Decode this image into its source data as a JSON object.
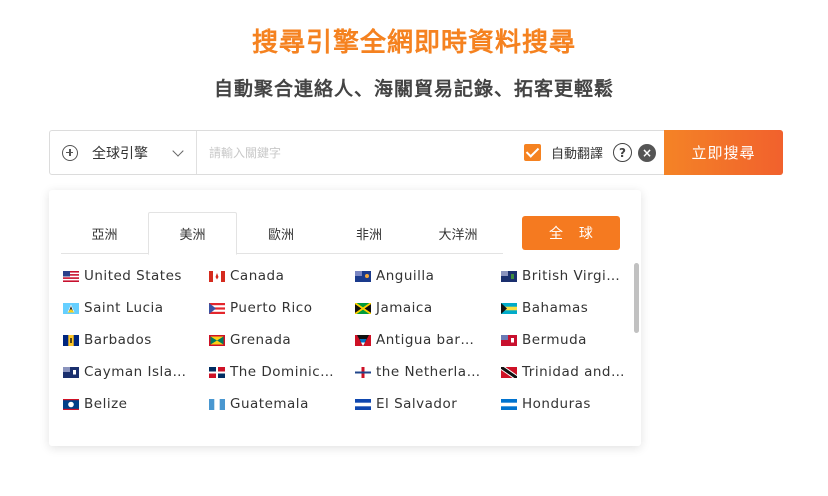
{
  "hero": {
    "title": "搜尋引擎全網即時資料搜尋",
    "subtitle": "自動聚合連絡人、海關貿易記錄、拓客更輕鬆"
  },
  "search": {
    "engine_label": "全球引擎",
    "placeholder": "請輸入關鍵字",
    "value": "",
    "auto_translate_label": "自動翻譯",
    "auto_translate_checked": true,
    "help_icon": "?",
    "clear_icon": "×",
    "submit_label": "立即搜尋"
  },
  "dropdown": {
    "tabs": [
      "亞洲",
      "美洲",
      "歐洲",
      "非洲",
      "大洋洲"
    ],
    "active_tab": "美洲",
    "all_label": "全 球",
    "countries": [
      [
        "United States",
        "Canada",
        "Anguilla",
        "British Virgi…"
      ],
      [
        "Saint Lucia",
        "Puerto Rico",
        "Jamaica",
        "Bahamas"
      ],
      [
        "Barbados",
        "Grenada",
        "Antigua bar…",
        "Bermuda"
      ],
      [
        "Cayman Isla…",
        "The Dominic…",
        "the Netherla…",
        "Trinidad and…"
      ],
      [
        "Belize",
        "Guatemala",
        "El Salvador",
        "Honduras"
      ]
    ],
    "flag_icons": [
      [
        "us-flag-icon",
        "ca-flag-icon",
        "ai-flag-icon",
        "vg-flag-icon"
      ],
      [
        "lc-flag-icon",
        "pr-flag-icon",
        "jm-flag-icon",
        "bs-flag-icon"
      ],
      [
        "bb-flag-icon",
        "gd-flag-icon",
        "ag-flag-icon",
        "bm-flag-icon"
      ],
      [
        "ky-flag-icon",
        "do-flag-icon",
        "an-flag-icon",
        "tt-flag-icon"
      ],
      [
        "bz-flag-icon",
        "gt-flag-icon",
        "sv-flag-icon",
        "hn-flag-icon"
      ]
    ]
  },
  "colors": {
    "accent": "#f58220",
    "button_gradient_start": "#f48326",
    "button_gradient_end": "#f1612d"
  }
}
